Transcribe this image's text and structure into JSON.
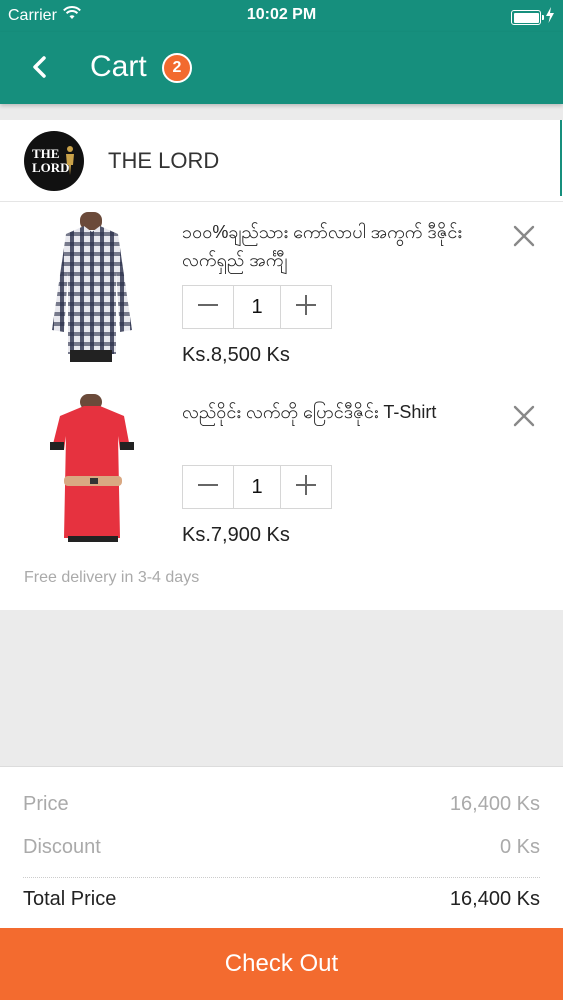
{
  "status_bar": {
    "carrier": "Carrier",
    "time": "10:02 PM"
  },
  "header": {
    "title": "Cart",
    "badge_count": "2"
  },
  "store": {
    "name": "THE LORD",
    "logo_text_line1": "THE",
    "logo_text_line2": "LORD"
  },
  "items": [
    {
      "title": "၁၀၀%ချည်သား ကော်လာပါ အကွက် ဒီဇိုင်း လက်ရှည် အင်္ကျီ",
      "quantity": "1",
      "price": "Ks.8,500 Ks"
    },
    {
      "title": "လည်ဝိုင်း လက်တို ပြောင်ဒီဇိုင်း T-Shirt",
      "quantity": "1",
      "price": "Ks.7,900 Ks"
    }
  ],
  "delivery_note": "Free delivery in 3-4 days",
  "summary": {
    "price_label": "Price",
    "price_value": "16,400 Ks",
    "discount_label": "Discount",
    "discount_value": "0 Ks",
    "total_label": "Total Price",
    "total_value": "16,400 Ks"
  },
  "checkout_label": "Check Out",
  "colors": {
    "primary": "#168f7d",
    "accent": "#f36b2f"
  },
  "icons": [
    "wifi-icon",
    "battery-icon",
    "charging-icon",
    "back-arrow-icon",
    "close-icon",
    "minus-icon",
    "plus-icon"
  ]
}
